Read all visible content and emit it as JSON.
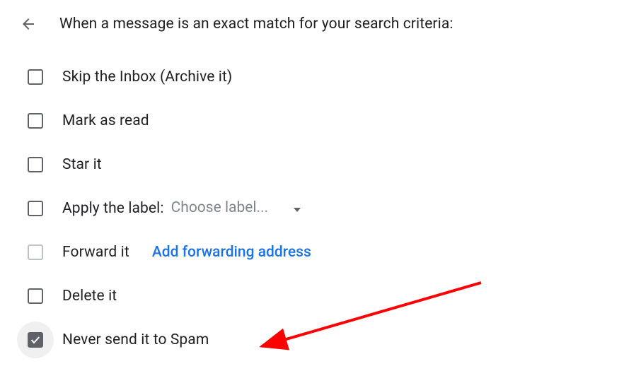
{
  "header": {
    "title": "When a message is an exact match for your search criteria:"
  },
  "options": {
    "skip_inbox": "Skip the Inbox (Archive it)",
    "mark_read": "Mark as read",
    "star_it": "Star it",
    "apply_label": "Apply the label:",
    "choose_label_placeholder": "Choose label...",
    "forward_it": "Forward it",
    "add_forwarding": "Add forwarding address",
    "delete_it": "Delete it",
    "never_spam": "Never send it to Spam"
  }
}
